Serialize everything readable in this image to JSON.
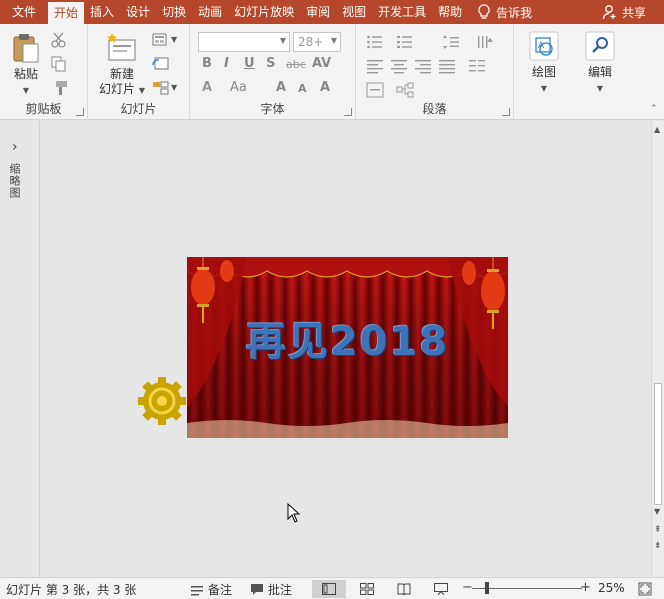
{
  "tabs": {
    "file": "文件",
    "home": "开始",
    "insert": "插入",
    "design": "设计",
    "transitions": "切换",
    "animations": "动画",
    "slideshow": "幻灯片放映",
    "review": "审阅",
    "view": "视图",
    "developer": "开发工具",
    "help": "帮助",
    "tell_me": "告诉我",
    "share": "共享"
  },
  "ribbon": {
    "clipboard": {
      "label": "剪贴板",
      "paste": "粘贴"
    },
    "slides": {
      "label": "幻灯片",
      "new_slide_line1": "新建",
      "new_slide_line2": "幻灯片"
    },
    "font": {
      "label": "字体",
      "font_size": "28+"
    },
    "paragraph": {
      "label": "段落"
    },
    "drawing": {
      "label": "绘图"
    },
    "editing": {
      "label": "编辑"
    }
  },
  "left_panel": {
    "label": "缩略图"
  },
  "slide": {
    "title_text": "再见2018"
  },
  "status": {
    "slide_info": "幻灯片 第 3 张，共 3 张",
    "notes": "备注",
    "comments": "批注",
    "zoom": "25%"
  },
  "colors": {
    "accent": "#b7472a",
    "curtain": "#b01010",
    "title_text": "#3f73b8",
    "gear": "#c9a400"
  },
  "icons": [
    "lightbulb-icon",
    "person-icon",
    "paste-icon",
    "cut-icon",
    "copy-icon",
    "format-painter-icon",
    "new-slide-icon",
    "layout-icon",
    "reset-icon",
    "section-icon",
    "drawing-icon",
    "search-icon",
    "gear-icon",
    "cursor-icon",
    "notes-icon",
    "comments-icon",
    "normal-view-icon",
    "slide-sorter-icon",
    "reading-view-icon",
    "slideshow-icon",
    "fit-window-icon"
  ]
}
